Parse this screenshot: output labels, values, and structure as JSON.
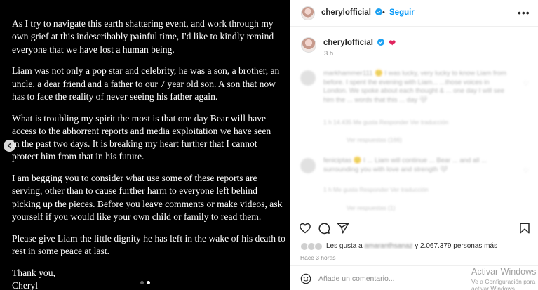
{
  "post": {
    "paragraphs": [
      "As I try to navigate this earth shattering event, and work through my\nown grief at this indescribably painful time, I'd like to kindly remind\neveryone that we have lost a human being.",
      "Liam was not only a pop star and celebrity, he was a son, a brother, an\nuncle, a dear friend and a father to our 7 year old son. A son that now\nhas to face the reality of never seeing his father again.",
      "What is troubling my spirit the most is that one day Bear will have\naccess to the abhorrent reports and media exploitation we have seen\nin the past two days. It is breaking my heart further that I cannot\nprotect him from that in his future.",
      "I am begging you to consider what use some of these reports are\nserving, other than to cause further harm to everyone left behind\npicking up the pieces. Before you leave comments or make videos, ask\nyourself if you would like your own child or family to read them.",
      "Please give Liam the little dignity he has left in the wake of his death to\nrest in some peace at last.",
      "Thank you,\nCheryl"
    ],
    "carousel_prev_icon": "chevron-left-icon"
  },
  "header": {
    "username": "cherylofficial",
    "separator": "•",
    "follow_label": "Seguir",
    "more_icon": "more-icon"
  },
  "caption": {
    "username": "cherylofficial",
    "emoji": "❤",
    "time": "3 h"
  },
  "comments": [
    {
      "text": "markhammer111 🙂 I was lucky, very lucky to know Liam from before. I spent the evening with Liam... ...those voices in London. We spoke about each thought & ... one day I will see him the ... words that this ... day 🤍",
      "meta": "1 h   14.435 Me gusta   Responder   Ver traducción",
      "replies": "Ver respuestas (166)"
    },
    {
      "text": "feniciptas 🙂 I ... Liam will continue ... Bear ... and all ... surrounding you with love and strength 🤍",
      "meta": "1 h   Me gusta   Responder   Ver traducción",
      "replies": "Ver respuestas (1)"
    }
  ],
  "actions": {
    "like_icon": "heart-icon",
    "comment_icon": "comment-icon",
    "share_icon": "share-icon",
    "save_icon": "bookmark-icon"
  },
  "likes": {
    "prefix": "Les gusta a",
    "blurred_name": "amaranthsanaz",
    "suffix": " y 2.067.379 personas más"
  },
  "time_ago": "Hace 3 horas",
  "comment_box": {
    "emoji_icon": "emoji-icon",
    "placeholder": "Añade un comentario..."
  },
  "watermark": {
    "title": "Activar Windows",
    "subtitle": "Ve a Configuración para activar Windows."
  },
  "colors": {
    "accent": "#0095f6",
    "heart": "#e0245e",
    "verified": "#1da1f2"
  }
}
